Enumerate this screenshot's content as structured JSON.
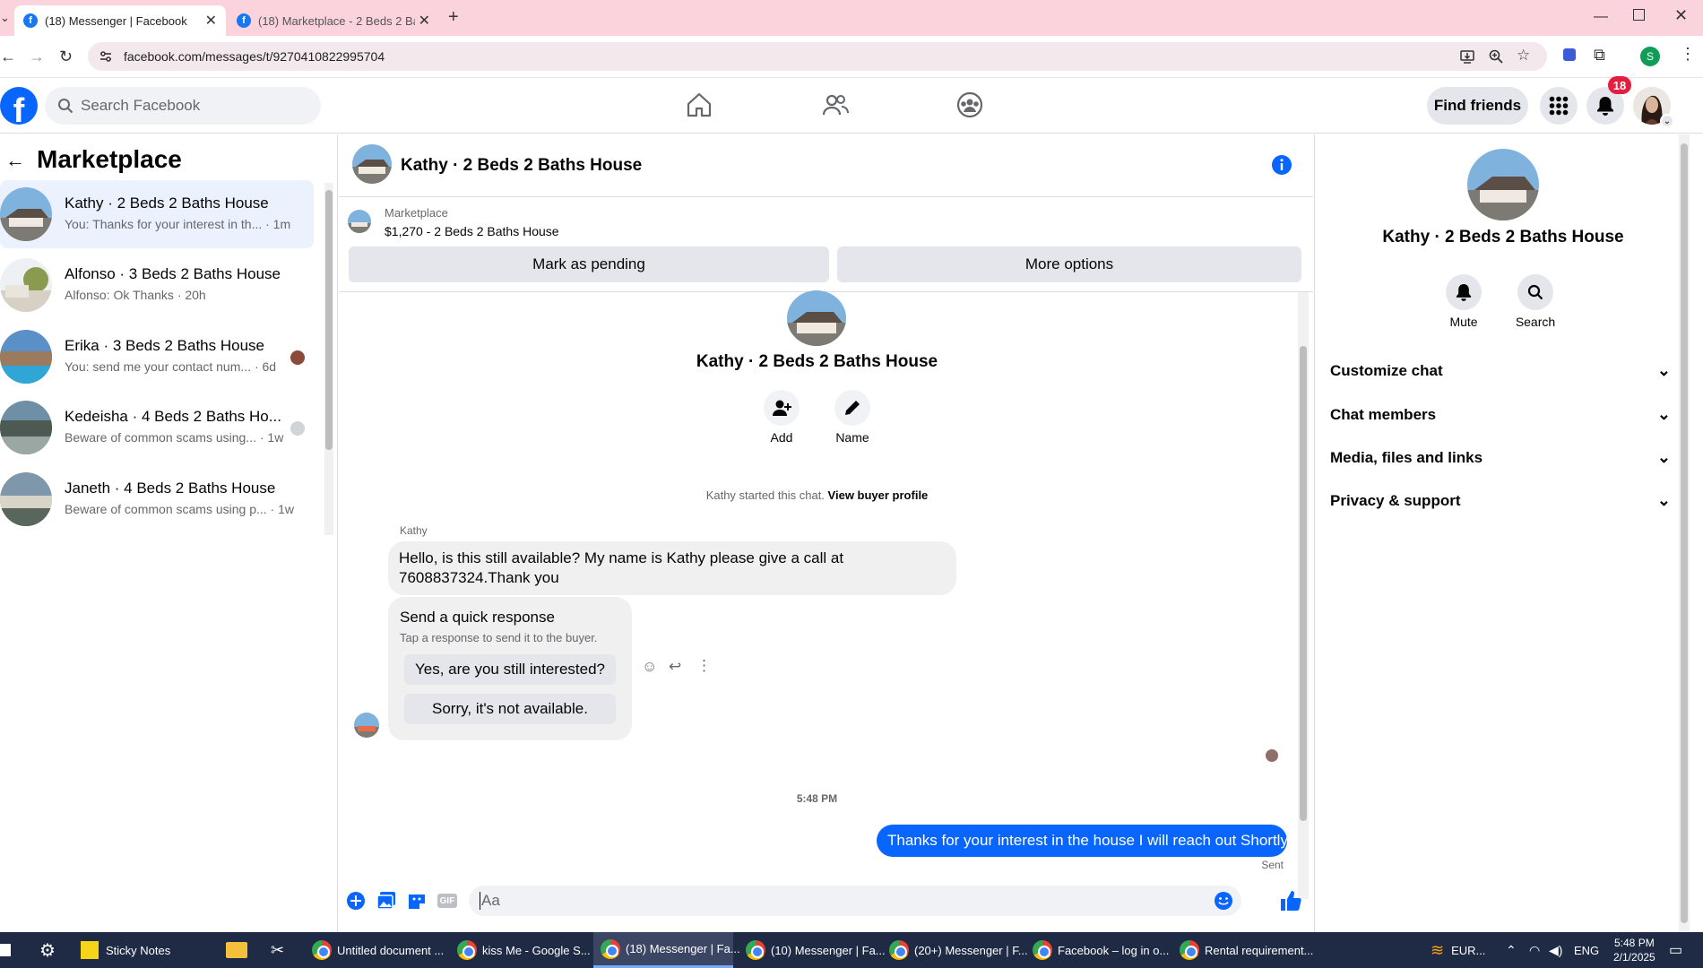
{
  "browser": {
    "tabs": [
      {
        "label": "(18) Messenger | Facebook",
        "active": true
      },
      {
        "label": "(18) Marketplace - 2 Beds 2 Bat",
        "active": false
      }
    ],
    "url": "facebook.com/messages/t/9270410822995704",
    "profile_initial": "S"
  },
  "fb_header": {
    "search_placeholder": "Search Facebook",
    "find_friends": "Find friends",
    "notification_count": "18"
  },
  "sidebar": {
    "title": "Marketplace",
    "conversations": [
      {
        "name": "Kathy · 2 Beds 2 Baths House",
        "preview": "You: Thanks for your interest in th...",
        "time": "· 1m",
        "active": true
      },
      {
        "name": "Alfonso · 3 Beds 2 Baths House",
        "preview": "Alfonso: Ok Thanks",
        "time": "· 20h",
        "active": false
      },
      {
        "name": "Erika · 3 Beds 2 Baths House",
        "preview": "You: send me your contact num...",
        "time": "· 6d",
        "active": false
      },
      {
        "name": "Kedeisha · 4 Beds 2 Baths Ho...",
        "preview": "Beware of common scams using...",
        "time": "· 1w",
        "active": false
      },
      {
        "name": "Janeth · 4 Beds 2 Baths House",
        "preview": "Beware of common scams using p...",
        "time": "· 1w",
        "active": false
      }
    ]
  },
  "chat": {
    "title": "Kathy · 2 Beds 2 Baths House",
    "listing": {
      "source": "Marketplace",
      "price_title": "$1,270 - 2 Beds 2 Baths House",
      "mark_pending": "Mark as pending",
      "more_options": "More options"
    },
    "intro": {
      "name": "Kathy · 2 Beds 2 Baths House",
      "add_label": "Add",
      "name_label": "Name",
      "started_text": "Kathy started this chat.",
      "view_profile": "View buyer profile"
    },
    "sender_name": "Kathy",
    "incoming_message": "Hello, is this still available? My name is Kathy please give a call at 7608837324.Thank you",
    "quick_response": {
      "title": "Send a quick response",
      "subtitle": "Tap a response to send it to the buyer.",
      "option1": "Yes, are you still interested?",
      "option2": "Sorry, it's not available."
    },
    "timestamp": "5:48 PM",
    "outgoing_message": "Thanks for your interest in the house I will reach out Shortly",
    "sent_status": "Sent",
    "composer_placeholder": "Aa"
  },
  "info_panel": {
    "name": "Kathy · 2 Beds 2 Baths House",
    "mute_label": "Mute",
    "search_label": "Search",
    "sections": [
      "Customize chat",
      "Chat members",
      "Media, files and links",
      "Privacy & support"
    ]
  },
  "taskbar": {
    "items": [
      "Sticky Notes",
      "Untitled document ...",
      "kiss Me - Google S...",
      "(18) Messenger | Fa...",
      "(10) Messenger | Fa...",
      "(20+) Messenger | F...",
      "Facebook – log in o...",
      "Rental requirement..."
    ],
    "currency": "EUR...",
    "language": "ENG",
    "time": "5:48 PM",
    "date": "2/1/2025"
  },
  "colors": {
    "tabbar": "#fbd3dc",
    "fb_blue": "#0866ff",
    "bubble_out": "#0866ff",
    "bubble_in": "#f0f0f0",
    "notification": "#e41e3f",
    "taskbar": "#1f2a44"
  }
}
